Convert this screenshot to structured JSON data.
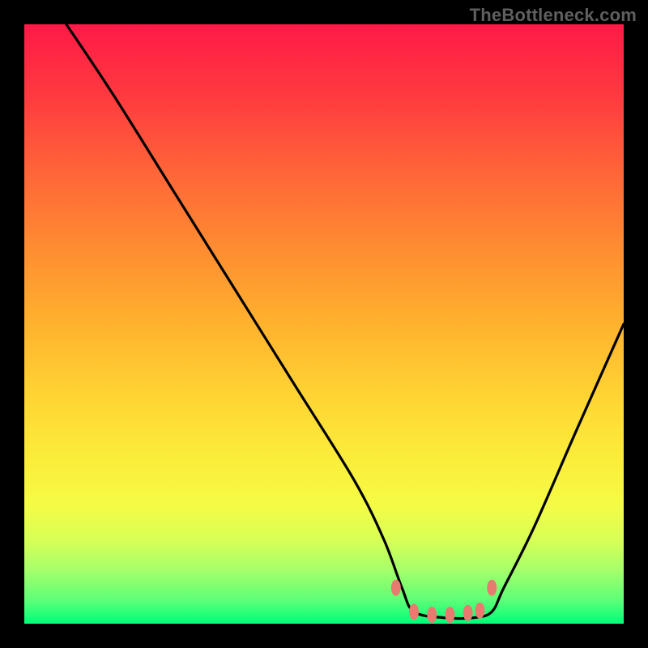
{
  "watermark": "TheBottleneck.com",
  "chart_data": {
    "type": "line",
    "title": "",
    "xlabel": "",
    "ylabel": "",
    "xlim": [
      0,
      100
    ],
    "ylim": [
      0,
      100
    ],
    "note": "Axes have no visible ticks or labels. y is interpreted as the curve height from the bottom of the gradient panel (0 = bottom/green = optimal, 100 = top/red = worst).",
    "series": [
      {
        "name": "bottleneck-curve",
        "x": [
          0,
          7,
          15,
          25,
          35,
          45,
          55,
          60,
          63,
          65,
          70,
          75,
          78,
          80,
          85,
          92,
          100
        ],
        "y": [
          110,
          100,
          88,
          72,
          56,
          40,
          24,
          14,
          6,
          2,
          1,
          1,
          2,
          6,
          16,
          32,
          50
        ]
      }
    ],
    "markers": [
      {
        "name": "valley-marker-left",
        "x": 62,
        "y": 6,
        "color": "#e97a70"
      },
      {
        "name": "valley-marker-right",
        "x": 78,
        "y": 6,
        "color": "#e97a70"
      },
      {
        "name": "valley-floor-1",
        "x": 65,
        "y": 2,
        "color": "#e97a70"
      },
      {
        "name": "valley-floor-2",
        "x": 68,
        "y": 1.5,
        "color": "#e97a70"
      },
      {
        "name": "valley-floor-3",
        "x": 71,
        "y": 1.5,
        "color": "#e97a70"
      },
      {
        "name": "valley-floor-4",
        "x": 74,
        "y": 1.8,
        "color": "#e97a70"
      },
      {
        "name": "valley-floor-5",
        "x": 76,
        "y": 2.2,
        "color": "#e97a70"
      }
    ]
  }
}
